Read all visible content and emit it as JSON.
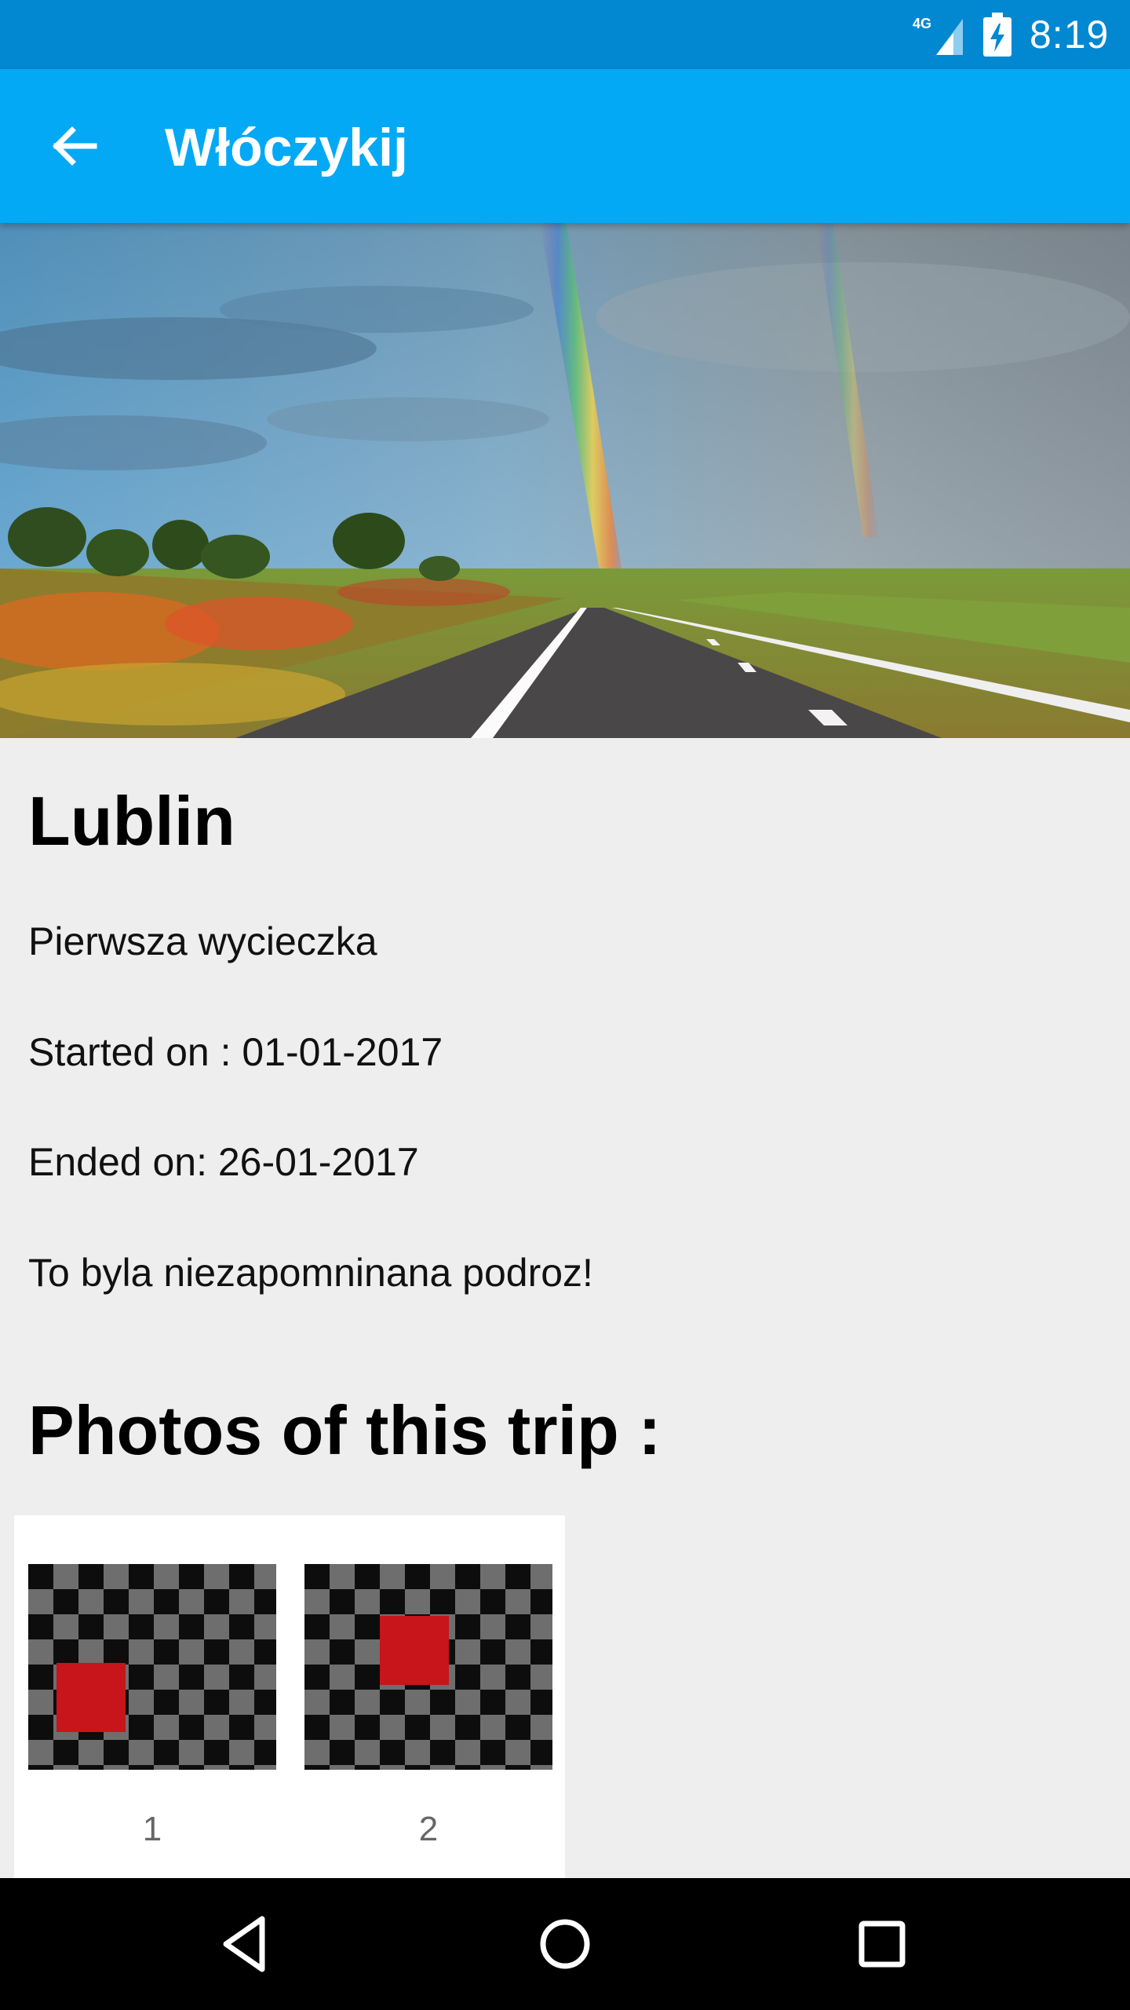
{
  "status_bar": {
    "network": "4G",
    "time": "8:19",
    "icons": [
      "signal-icon",
      "battery-charging-icon"
    ]
  },
  "app_bar": {
    "title": "Włóczykij",
    "back_icon": "arrow-back-icon",
    "background": "#03a9f4"
  },
  "trip": {
    "name": "Lublin",
    "description": "Pierwsza wycieczka",
    "started": "Started on : 01-01-2017",
    "ended": "Ended on: 26-01-2017",
    "note": "To byla niezapomninana podroz!"
  },
  "photos": {
    "heading": "Photos of this trip :",
    "items": [
      {
        "label": "1"
      },
      {
        "label": "2"
      }
    ]
  },
  "nav_bar": {
    "icons": [
      "back-triangle-icon",
      "home-circle-icon",
      "recents-square-icon"
    ]
  },
  "colors": {
    "status_bar": "#0288d1",
    "app_bar": "#03a9f4",
    "placeholder_red": "#c8141b"
  }
}
